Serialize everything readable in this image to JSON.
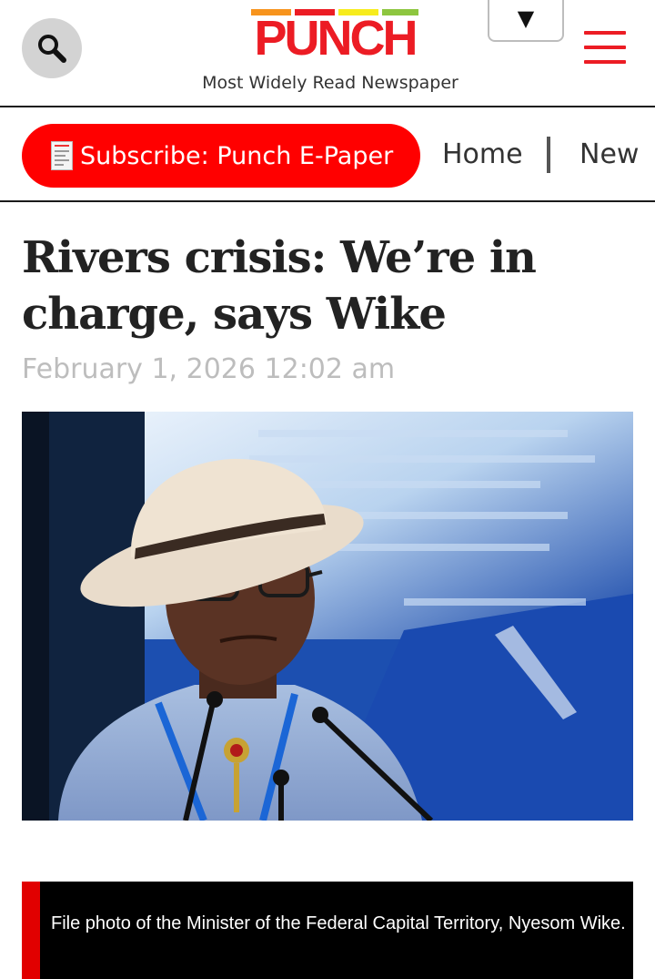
{
  "header": {
    "logo_text": "PUNCH",
    "tagline": "Most Widely Read Newspaper",
    "dropdown_symbol": "▼",
    "search_icon": "search-icon",
    "menu_icon": "hamburger-menu-icon"
  },
  "nav": {
    "subscribe_label": "Subscribe: Punch E-Paper",
    "subscribe_icon": "newspaper-icon",
    "items": [
      {
        "label": "Home"
      },
      {
        "label": "New"
      }
    ]
  },
  "article": {
    "headline": "Rivers crisis: We’re in charge, says Wike",
    "date": "February 1, 2026 12:02 am",
    "image_caption": "File photo of the Minister of the Federal Capital Territory, Nyesom Wike."
  },
  "colors": {
    "brand_red": "#ec1c24",
    "subscribe_bg": "#ff0000",
    "caption_bg": "#000000",
    "caption_accent": "#e10000"
  }
}
